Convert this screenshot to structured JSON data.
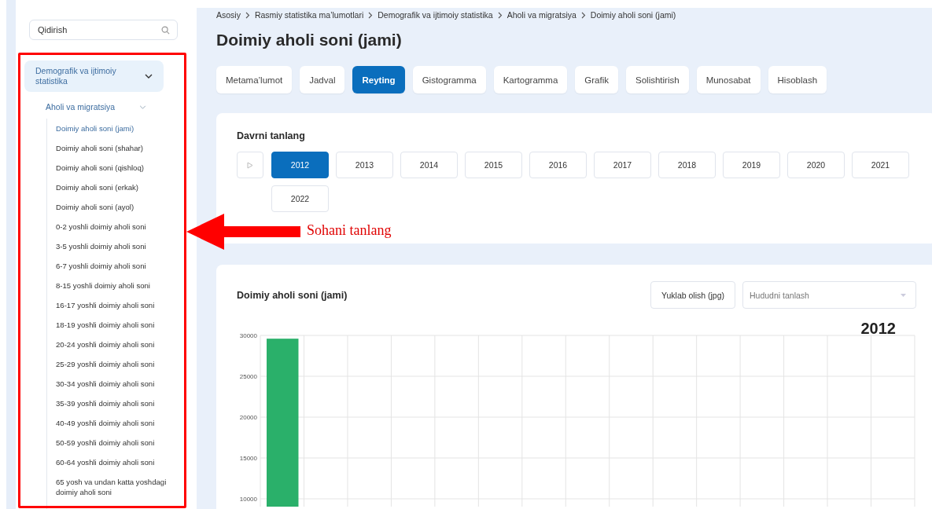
{
  "sidebar": {
    "search": {
      "placeholder": "Qidirish"
    },
    "tree": [
      {
        "label": "Demografik va ijtimoiy statistika",
        "selected": true,
        "expanded": true,
        "children": [
          {
            "label": "Aholi va migratsiya",
            "selected": false,
            "expanded": true,
            "children": [
              {
                "label": "Doimiy aholi soni (jami)",
                "selected": true
              },
              {
                "label": "Doimiy aholi soni (shahar)",
                "selected": false
              },
              {
                "label": "Doimiy aholi soni (qishloq)",
                "selected": false
              },
              {
                "label": "Doimiy aholi soni (erkak)",
                "selected": false
              },
              {
                "label": "Doimiy aholi soni (ayol)",
                "selected": false
              },
              {
                "label": "0-2 yoshli doimiy aholi soni",
                "selected": false
              },
              {
                "label": "3-5 yoshli doimiy aholi soni",
                "selected": false
              },
              {
                "label": "6-7 yoshli doimiy aholi soni",
                "selected": false
              },
              {
                "label": "8-15 yoshli doimiy aholi soni",
                "selected": false
              },
              {
                "label": "16-17 yoshli doimiy aholi soni",
                "selected": false
              },
              {
                "label": "18-19 yoshli doimiy aholi soni",
                "selected": false
              },
              {
                "label": "20-24 yoshli doimiy aholi soni",
                "selected": false
              },
              {
                "label": "25-29 yoshli doimiy aholi soni",
                "selected": false
              },
              {
                "label": "30-34 yoshli doimiy aholi soni",
                "selected": false
              },
              {
                "label": "35-39 yoshli doimiy aholi soni",
                "selected": false
              },
              {
                "label": "40-49 yoshli doimiy aholi soni",
                "selected": false
              },
              {
                "label": "50-59 yoshli doimiy aholi soni",
                "selected": false
              },
              {
                "label": "60-64 yoshli doimiy aholi soni",
                "selected": false
              },
              {
                "label": "65 yosh va undan katta yoshdagi doimiy aholi soni",
                "selected": false
              }
            ]
          }
        ]
      }
    ]
  },
  "breadcrumb": [
    "Asosiy",
    "Rasmiy statistika ma’lumotlari",
    "Demografik va ijtimoiy statistika",
    "Aholi va migratsiya",
    "Doimiy aholi soni (jami)"
  ],
  "page_title": "Doimiy aholi soni (jami)",
  "tabs": [
    {
      "label": "Metama’lumot",
      "selected": false
    },
    {
      "label": "Jadval",
      "selected": false
    },
    {
      "label": "Reyting",
      "selected": true
    },
    {
      "label": "Gistogramma",
      "selected": false
    },
    {
      "label": "Kartogramma",
      "selected": false
    },
    {
      "label": "Grafik",
      "selected": false
    },
    {
      "label": "Solishtirish",
      "selected": false
    },
    {
      "label": "Munosabat",
      "selected": false
    },
    {
      "label": "Hisoblash",
      "selected": false
    }
  ],
  "period": {
    "title": "Davrni tanlang",
    "years": [
      {
        "label": "2012",
        "selected": true
      },
      {
        "label": "2013",
        "selected": false
      },
      {
        "label": "2014",
        "selected": false
      },
      {
        "label": "2015",
        "selected": false
      },
      {
        "label": "2016",
        "selected": false
      },
      {
        "label": "2017",
        "selected": false
      },
      {
        "label": "2018",
        "selected": false
      },
      {
        "label": "2019",
        "selected": false
      },
      {
        "label": "2020",
        "selected": false
      },
      {
        "label": "2021",
        "selected": false
      },
      {
        "label": "2022",
        "selected": false
      }
    ]
  },
  "chart_panel": {
    "title": "Doimiy aholi soni (jami)",
    "download_button": "Yuklab olish (jpg)",
    "region_select": {
      "placeholder": "Hududni tanlash"
    },
    "year_label": "2012",
    "chart_data": {
      "type": "bar",
      "grid": true,
      "ylim": [
        9000,
        30000
      ],
      "yticks": [
        10000,
        15000,
        20000,
        25000,
        30000
      ],
      "values": [
        29600,
        null,
        null,
        null,
        null,
        null,
        null,
        null,
        null,
        null,
        null,
        null,
        null,
        null,
        null
      ]
    }
  },
  "annotation": {
    "text": "Sohani tanlang"
  }
}
